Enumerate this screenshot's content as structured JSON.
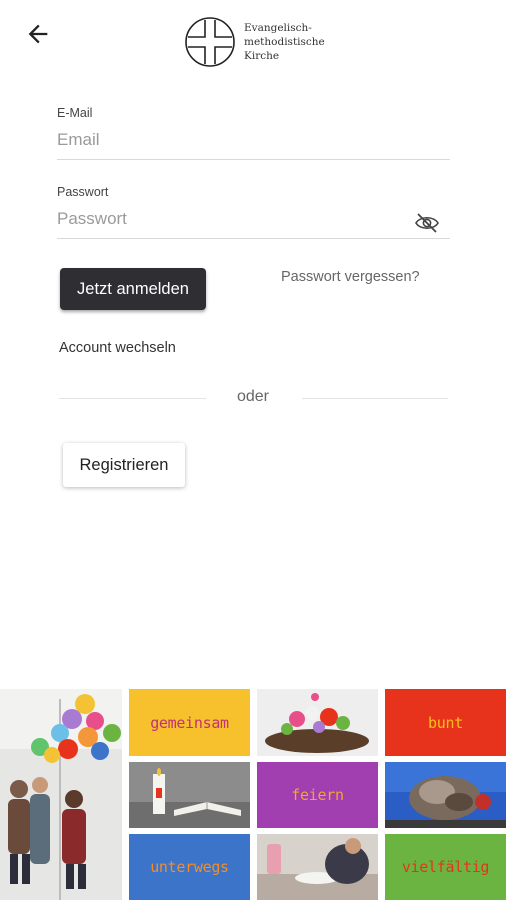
{
  "header": {
    "logo_text": [
      "Evangelisch-",
      "methodistische",
      "Kirche"
    ]
  },
  "form": {
    "email_label": "E-Mail",
    "email_placeholder": "Email",
    "password_label": "Passwort",
    "password_placeholder": "Passwort",
    "login_button": "Jetzt anmelden",
    "forgot_link": "Passwort vergessen?",
    "switch_account": "Account wechseln",
    "separator": "oder",
    "register_button": "Registrieren"
  },
  "tiles": [
    {
      "word": "gemeinsam",
      "bg": "#f6c12c",
      "color": "#c2307a"
    },
    {
      "word": "bunt",
      "bg": "#e8331c",
      "color": "#f2c21a"
    },
    {
      "word": "feiern",
      "bg": "#a13fb0",
      "color": "#f2a62a"
    },
    {
      "word": "unterwegs",
      "bg": "#3b74c9",
      "color": "#f28d2a"
    },
    {
      "word": "vielfältig",
      "bg": "#6cb442",
      "color": "#e8331c"
    }
  ],
  "colors": {
    "button_dark": "#2e2e33",
    "accent": "#2e2e33"
  },
  "icons": {
    "back": "arrow-left-icon",
    "visibility": "eye-off-icon"
  }
}
